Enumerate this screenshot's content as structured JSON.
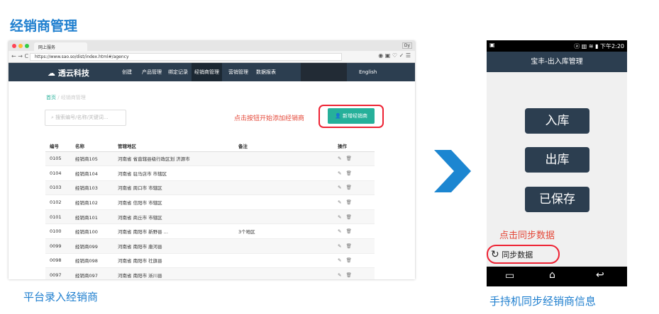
{
  "title": "经销商管理",
  "browser": {
    "tab": "网上服务",
    "profile": "Dy",
    "url": "https://www.sao.so/dist/index.html#/agency",
    "logo": "透云科技",
    "nav": [
      "创建",
      "产品管理",
      "绑定记录",
      "经销商管理",
      "营销管理",
      "数据报表"
    ],
    "active_nav": "经销商管理",
    "lang": "English",
    "breadcrumb": [
      "首页",
      "经销商管理"
    ],
    "search_placeholder": "搜索编号/名称/关键词...",
    "hint": "点击按钮开始添加经销商",
    "add_button": "新增经销商",
    "columns": [
      "编号",
      "名称",
      "管辖地区",
      "备注",
      "操作"
    ],
    "rows": [
      [
        "0105",
        "经销商105",
        "河南省 省直辖县级行政区划 济源市",
        ""
      ],
      [
        "0104",
        "经销商104",
        "河南省 驻马店市 市辖区",
        ""
      ],
      [
        "0103",
        "经销商103",
        "河南省 周口市 市辖区",
        ""
      ],
      [
        "0102",
        "经销商102",
        "河南省 信阳市 市辖区",
        ""
      ],
      [
        "0101",
        "经销商101",
        "河南省 商丘市 市辖区",
        ""
      ],
      [
        "0100",
        "经销商100",
        "河南省 南阳市 新野县 ...",
        "3个地区"
      ],
      [
        "0099",
        "经销商099",
        "河南省 南阳市 唐河县",
        ""
      ],
      [
        "0098",
        "经销商098",
        "河南省 南阳市 社旗县",
        ""
      ],
      [
        "0097",
        "经销商097",
        "河南省 南阳市 淅川县",
        ""
      ]
    ]
  },
  "phone": {
    "time": "下午2:20",
    "title": "宝丰-出入库管理",
    "buttons": [
      "入库",
      "出库",
      "已保存"
    ],
    "sync_hint": "点击同步数据",
    "sync_label": "同步数据",
    "accent": "#2c3e50"
  },
  "captions": {
    "left": "平台录入经销商",
    "right": "手持机同步经销商信息"
  },
  "colors": {
    "brand_blue": "#1f7fcf",
    "highlight_red": "#e23",
    "teal": "#26b09a"
  }
}
